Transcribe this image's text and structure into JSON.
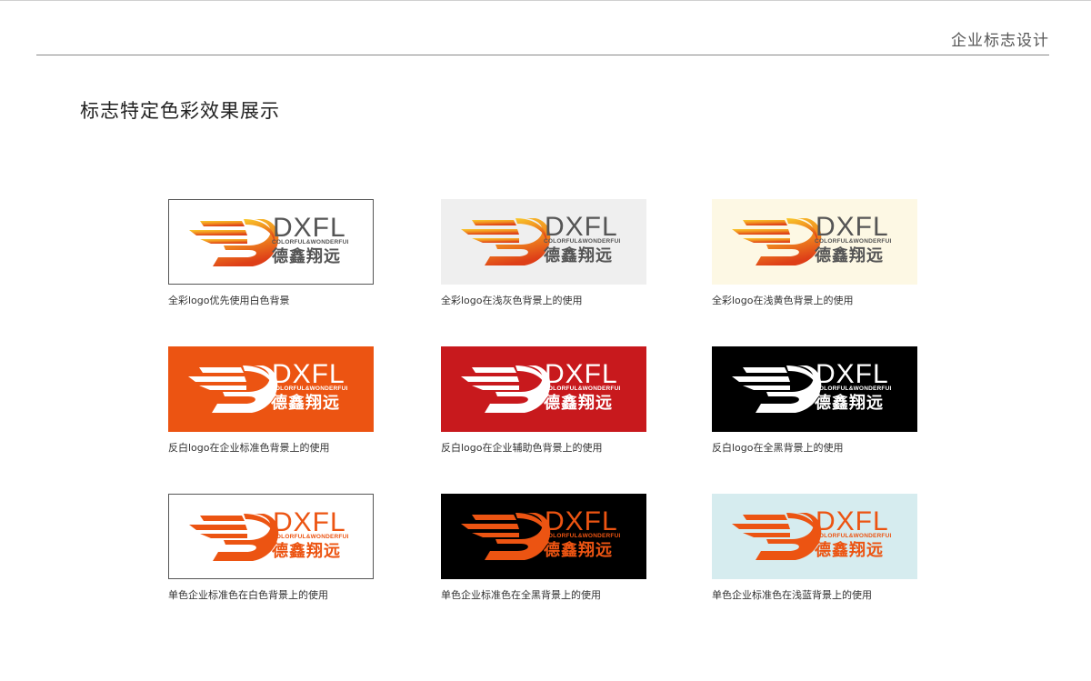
{
  "header": {
    "title": "企业标志设计"
  },
  "page_title": "标志特定色彩效果展示",
  "logo": {
    "wordmark": "DXFL",
    "tagline": "COLORFUL&WONDERFUL",
    "chinese_name": "德鑫翔远"
  },
  "colors": {
    "brand_orange": "#ec5412",
    "brand_red": "#c8191d",
    "light_gray_bg": "#efefef",
    "light_yellow_bg": "#fdf8e4",
    "light_blue_bg": "#d6ecef",
    "black_bg": "#000000",
    "gradient_top": "#f7c12a",
    "gradient_bottom": "#e2481a",
    "text_gray": "#555555"
  },
  "cards": [
    {
      "caption": "全彩logo优先使用白色背景",
      "bg": "#ffffff",
      "bordered": true,
      "mark": "gradient",
      "text": "#555555"
    },
    {
      "caption": "全彩logo在浅灰色背景上的使用",
      "bg": "#efefef",
      "bordered": false,
      "mark": "gradient",
      "text": "#555555"
    },
    {
      "caption": "全彩logo在浅黄色背景上的使用",
      "bg": "#fdf8e4",
      "bordered": false,
      "mark": "gradient",
      "text": "#555555"
    },
    {
      "caption": "反白logo在企业标准色背景上的使用",
      "bg": "#ec5412",
      "bordered": false,
      "mark": "#ffffff",
      "text": "#ffffff"
    },
    {
      "caption": "反白logo在企业辅助色背景上的使用",
      "bg": "#c8191d",
      "bordered": false,
      "mark": "#ffffff",
      "text": "#ffffff"
    },
    {
      "caption": "反白logo在全黑背景上的使用",
      "bg": "#000000",
      "bordered": false,
      "mark": "#ffffff",
      "text": "#ffffff"
    },
    {
      "caption": "单色企业标准色在白色背景上的使用",
      "bg": "#ffffff",
      "bordered": true,
      "mark": "#ec5412",
      "text": "#ec5412"
    },
    {
      "caption": "单色企业标准色在全黑背景上的使用",
      "bg": "#000000",
      "bordered": false,
      "mark": "#ec5412",
      "text": "#ec5412"
    },
    {
      "caption": "单色企业标准色在浅蓝背景上的使用",
      "bg": "#d6ecef",
      "bordered": false,
      "mark": "#ec5412",
      "text": "#ec5412"
    }
  ]
}
